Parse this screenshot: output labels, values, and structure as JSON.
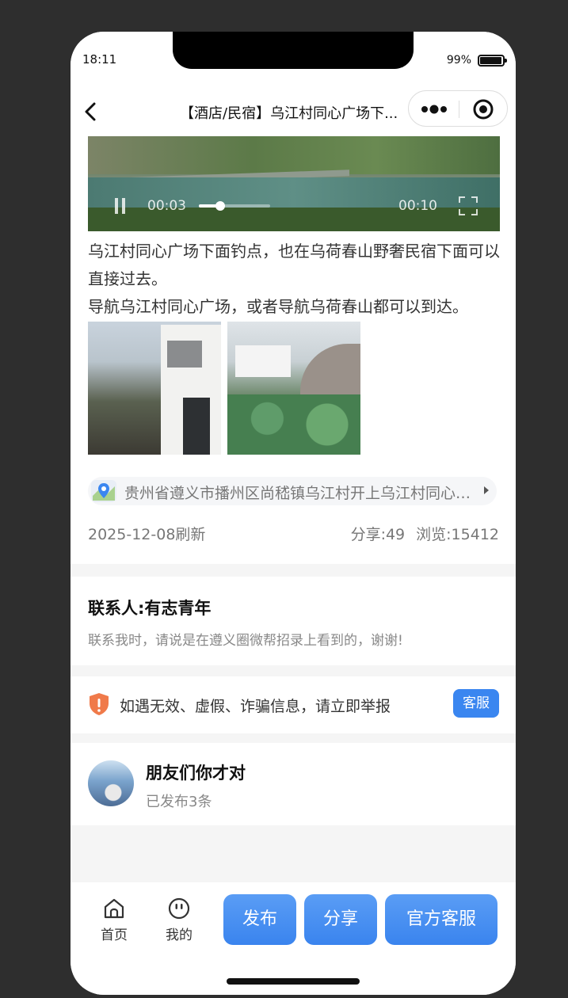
{
  "status": {
    "time": "18:11",
    "battery": "99%"
  },
  "nav": {
    "title": "【酒店/民宿】乌江村同心广场下..."
  },
  "video": {
    "current": "00:03",
    "total": "00:10",
    "progress": 0.3
  },
  "post": {
    "desc_line1": "乌江村同心广场下面钓点，也在乌荷春山野奢民宿下面可以直接过去。",
    "desc_line2": "导航乌江村同心广场，或者导航乌荷春山都可以到达。",
    "location": "贵州省遵义市播州区尚嵇镇乌江村开上乌江村同心广场",
    "date": "2025-12-08刷新",
    "share": "分享:49",
    "views": "浏览:15412"
  },
  "contact": {
    "name": "联系人:有志青年",
    "note": "联系我时，请说是在遵义圈微帮招录上看到的，谢谢!"
  },
  "report": {
    "text": "如遇无效、虚假、诈骗信息，请立即举报",
    "button": "客服"
  },
  "user": {
    "name": "朋友们你才对",
    "posts": "已发布3条"
  },
  "tabbar": {
    "home": "首页",
    "me": "我的",
    "publish": "发布",
    "share": "分享",
    "service": "官方客服"
  },
  "colors": {
    "accent": "#3a86f0",
    "shield": "#f07a4a"
  }
}
